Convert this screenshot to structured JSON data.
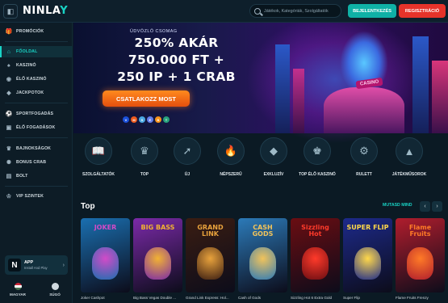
{
  "header": {
    "logo_main": "NINLA",
    "logo_accent": "Y",
    "search_placeholder": "Játékok, Kategóriák, Szolgáltatók",
    "login_label": "BEJELENTKEZÉS",
    "register_label": "REGISZTRÁCIÓ"
  },
  "sidebar": {
    "items": [
      {
        "label": "PROMÓCIÓK",
        "icon": "gift-icon"
      },
      {
        "label": "FŐOLDAL",
        "icon": "home-icon",
        "active": true
      },
      {
        "label": "KASZINÓ",
        "icon": "cards-icon"
      },
      {
        "label": "ÉLŐ KASZINÓ",
        "icon": "live-icon"
      },
      {
        "label": "JACKPOTOK",
        "icon": "jackpot-icon"
      },
      {
        "label": "SPORTFOGADÁS",
        "icon": "ball-icon"
      },
      {
        "label": "ÉLŐ FOGADÁSOK",
        "icon": "live-bet-icon"
      },
      {
        "label": "BAJNOKSÁGOK",
        "icon": "trophy-icon"
      },
      {
        "label": "BONUS CRAB",
        "icon": "crab-icon"
      },
      {
        "label": "BOLT",
        "icon": "shop-icon"
      },
      {
        "label": "VIP SZINTEK",
        "icon": "crown-icon"
      }
    ],
    "app": {
      "title": "APP",
      "subtitle": "Install And Play"
    },
    "language": "MAGYAR",
    "support": "SÚGÓ"
  },
  "hero": {
    "small_text": "ÜDVÖZLŐ CSOMAG",
    "line1": "250% AKÁR",
    "line2": "750.000 FT +",
    "line3": "250 IP + 1 CRAB",
    "cta": "CSATLAKOZZ MOST",
    "sign": "CASINO"
  },
  "categories": [
    {
      "label": "SZOLGÁLTATÓK",
      "icon": "book-icon"
    },
    {
      "label": "TOP",
      "icon": "crown-icon"
    },
    {
      "label": "ÚJ",
      "icon": "rocket-icon"
    },
    {
      "label": "NÉPSZERŰ",
      "icon": "flame-icon"
    },
    {
      "label": "EXKLUZÍV",
      "icon": "diamond-icon"
    },
    {
      "label": "TOP ÉLŐ KASZINÓ",
      "icon": "live-dealer-icon"
    },
    {
      "label": "RULETT",
      "icon": "roulette-icon"
    },
    {
      "label": "JÁTÉKMŰSOROK",
      "icon": "gameshow-icon"
    }
  ],
  "top_section": {
    "title": "Top",
    "show_more": "MUTASD MIND",
    "games": [
      {
        "name": "Joker Cashpot",
        "art_title": "JOKER",
        "bg": "#1a6fb0",
        "accent": "#d24bc8"
      },
      {
        "name": "Big Bass Vegas Double ...",
        "art_title": "BIG BASS",
        "bg": "#7b2aa8",
        "accent": "#f2b233"
      },
      {
        "name": "Grand Link Express: Hol...",
        "art_title": "GRAND LINK",
        "bg": "#3a1d12",
        "accent": "#e8a23c"
      },
      {
        "name": "Cash of Gods",
        "art_title": "CASH GODS",
        "bg": "#2c7ab8",
        "accent": "#f1c35b"
      },
      {
        "name": "Sizzling Hot 6 Extra Gold",
        "art_title": "Sizzling Hot",
        "bg": "#6a0d12",
        "accent": "#ff3a2a"
      },
      {
        "name": "Super Flip",
        "art_title": "SUPER FLIP",
        "bg": "#1d2a8a",
        "accent": "#ffd84a"
      },
      {
        "name": "Flame Fruits Frenzy",
        "art_title": "Flame Fruits",
        "bg": "#b01d2d",
        "accent": "#ff7b27"
      }
    ]
  },
  "colors": {
    "accent": "#19d3c5",
    "login": "#0fb1a6",
    "register": "#e6332a",
    "cta": "#ff8a1e"
  }
}
